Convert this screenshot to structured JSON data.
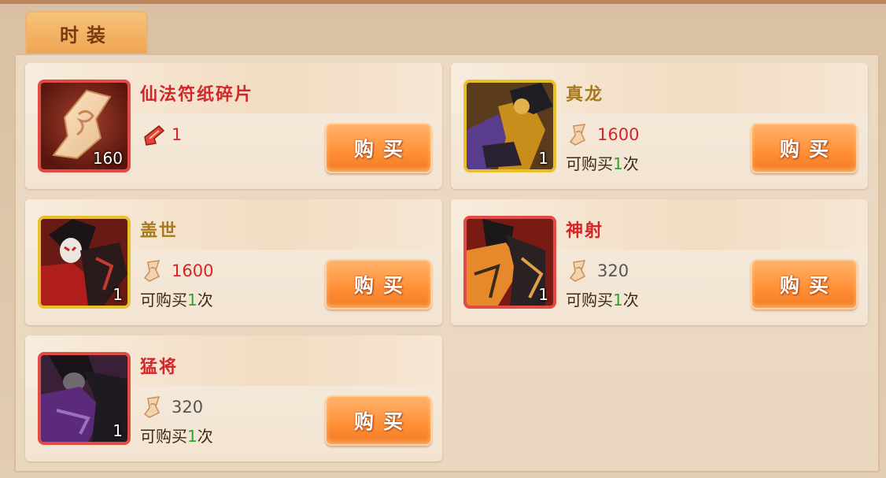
{
  "tab": {
    "label": "时装"
  },
  "items": [
    {
      "name": "仙法符纸碎片",
      "name_color": "red",
      "frame": "red",
      "icon": "paper-talisman-icon",
      "qty": "160",
      "price": "1",
      "price_color": "red",
      "limit_prefix": "",
      "limit_num": "",
      "limit_suffix": "",
      "buy_label": "购买"
    },
    {
      "name": "真龙",
      "name_color": "gold",
      "frame": "gold",
      "icon": "costume-zhenlong-portrait",
      "qty": "1",
      "price": "1600",
      "price_color": "red",
      "limit_prefix": "可购买",
      "limit_num": "1",
      "limit_suffix": "次",
      "buy_label": "购买"
    },
    {
      "name": "盖世",
      "name_color": "gold",
      "frame": "gold",
      "icon": "costume-gaishi-portrait",
      "qty": "1",
      "price": "1600",
      "price_color": "red",
      "limit_prefix": "可购买",
      "limit_num": "1",
      "limit_suffix": "次",
      "buy_label": "购买"
    },
    {
      "name": "神射",
      "name_color": "red",
      "frame": "red",
      "icon": "costume-shenshe-portrait",
      "qty": "1",
      "price": "320",
      "price_color": "gray",
      "limit_prefix": "可购买",
      "limit_num": "1",
      "limit_suffix": "次",
      "buy_label": "购买"
    },
    {
      "name": "猛将",
      "name_color": "red",
      "frame": "red",
      "icon": "costume-mengjiang-portrait",
      "qty": "1",
      "price": "320",
      "price_color": "gray",
      "limit_prefix": "可购买",
      "limit_num": "1",
      "limit_suffix": "次",
      "buy_label": "购买"
    }
  ],
  "currency_icon": "talisman-paper-icon",
  "colors": {
    "red_name": "#d3262a",
    "gold_name": "#a77a1e",
    "buy_button": "#ff8f35",
    "limit_number": "#2ea32e"
  }
}
